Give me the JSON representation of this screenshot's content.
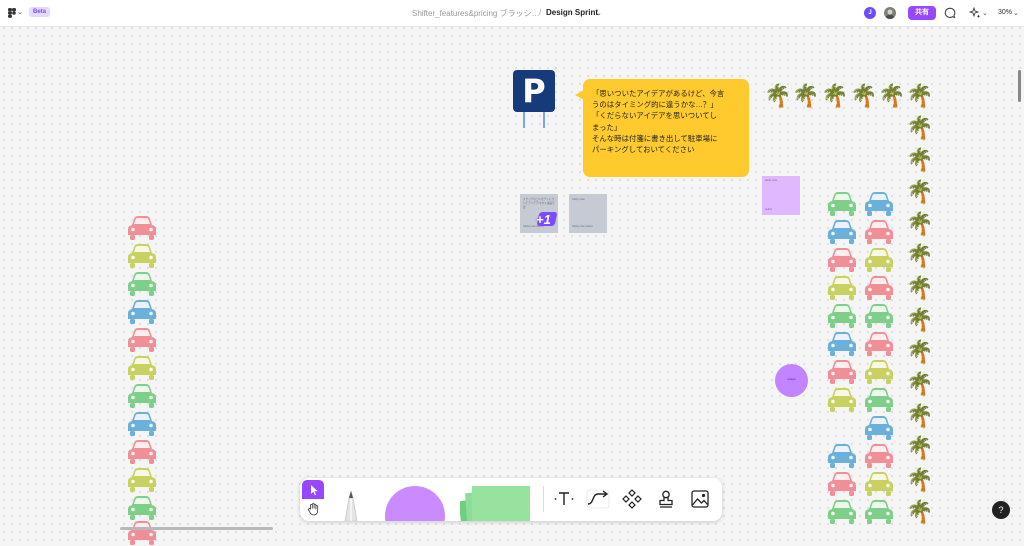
{
  "header": {
    "beta_label": "Beta",
    "file_path": "Shifter_features&pricing ブラッシ…",
    "separator": "/",
    "page_title": "Design Sprint",
    "avatar_initial": "J",
    "share_label": "共有",
    "zoom": "30%"
  },
  "canvas": {
    "parking_sign": "P",
    "bubble_lines": [
      "「思いついたアイデアがあるけど、今言",
      "うのはタイミング的に違うかな…？」",
      "「くだらないアイデアを思いついてし",
      "まった」",
      "そんな時は付箋に書き出して駐車場に",
      "パーキングしておいてください"
    ],
    "card1_text": "スケッチのコンセプトについてアイデア/今すぐ議論不要",
    "card1_footer": "Sticky note author",
    "card2_text": "Sticky note",
    "card2_footer": "Sticky note author",
    "plus_one": "+1",
    "sticky_text": "sticky note",
    "sticky_footer": "author",
    "circle_text": "shape",
    "palm_icon": "🌴",
    "car_colors": [
      "#f08f95",
      "#c8d162",
      "#7fcf8a",
      "#6bb0d8"
    ]
  },
  "toolbar": {
    "tools": [
      "select-tool",
      "hand-tool",
      "pen-tool",
      "shape-tool",
      "sticky-tool",
      "text-tool",
      "connector-tool",
      "component-tool",
      "stamp-tool",
      "image-tool"
    ]
  },
  "help_label": "?"
}
